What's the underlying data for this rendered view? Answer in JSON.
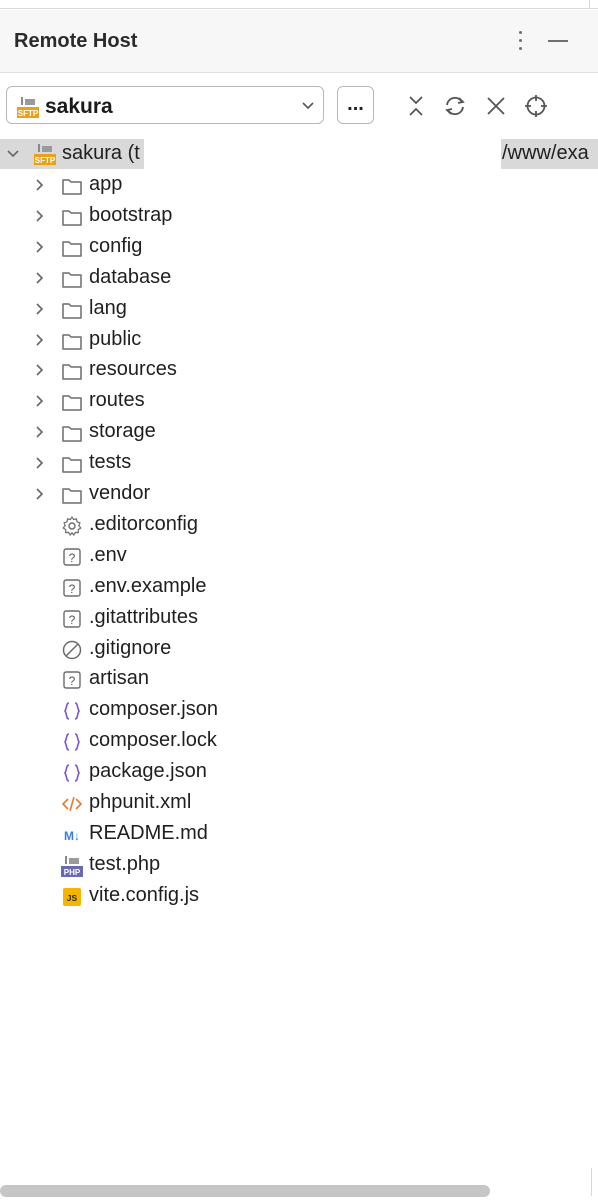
{
  "panel": {
    "title": "Remote Host"
  },
  "toolbar": {
    "server_label": "sakura",
    "more_label": "...",
    "icons": [
      "collapse-all-icon",
      "refresh-icon",
      "close-icon",
      "locate-icon"
    ]
  },
  "tree": {
    "root": {
      "label": "sakura (t",
      "path_tail": "/www/exa",
      "icon": "sftp-icon"
    },
    "items": [
      {
        "label": "app",
        "type": "folder"
      },
      {
        "label": "bootstrap",
        "type": "folder"
      },
      {
        "label": "config",
        "type": "folder"
      },
      {
        "label": "database",
        "type": "folder"
      },
      {
        "label": "lang",
        "type": "folder"
      },
      {
        "label": "public",
        "type": "folder"
      },
      {
        "label": "resources",
        "type": "folder"
      },
      {
        "label": "routes",
        "type": "folder"
      },
      {
        "label": "storage",
        "type": "folder"
      },
      {
        "label": "tests",
        "type": "folder"
      },
      {
        "label": "vendor",
        "type": "folder"
      },
      {
        "label": ".editorconfig",
        "type": "gear"
      },
      {
        "label": ".env",
        "type": "unknown"
      },
      {
        "label": ".env.example",
        "type": "unknown"
      },
      {
        "label": ".gitattributes",
        "type": "unknown"
      },
      {
        "label": ".gitignore",
        "type": "ignore"
      },
      {
        "label": "artisan",
        "type": "unknown"
      },
      {
        "label": "composer.json",
        "type": "json"
      },
      {
        "label": "composer.lock",
        "type": "json"
      },
      {
        "label": "package.json",
        "type": "json"
      },
      {
        "label": "phpunit.xml",
        "type": "xml"
      },
      {
        "label": "README.md",
        "type": "markdown"
      },
      {
        "label": "test.php",
        "type": "php"
      },
      {
        "label": "vite.config.js",
        "type": "js"
      }
    ]
  },
  "icon_text": {
    "sftp": "SFTP",
    "php": "PHP",
    "js": "JS",
    "md": "M↓"
  },
  "colors": {
    "json_icon": "#7b57d8",
    "xml_icon": "#e07b39",
    "markdown_icon": "#3d7de0",
    "php_icon": "#6a6ab0",
    "js_icon": "#f4b400",
    "sftp_icon": "#e8a21a",
    "selection": "#d9d9d9"
  }
}
